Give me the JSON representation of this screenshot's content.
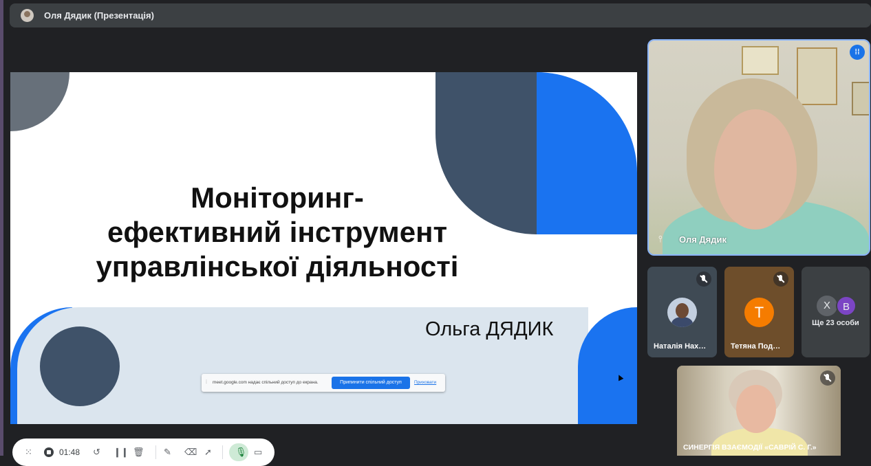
{
  "window": {
    "title": "Оля Дядик (Презентація)"
  },
  "slide": {
    "title_lines": [
      "Моніторинг-",
      "ефективний інструмент",
      "управлінської діяльності"
    ],
    "author": "Ольга ДЯДИК"
  },
  "share_bar": {
    "message": "meet.google.com надає спільний доступ до екрана.",
    "stop_label": "Припинити спільний доступ",
    "hide_label": "Приховати"
  },
  "participants": {
    "main": {
      "name": "Оля Дядик",
      "speaking": true
    },
    "tiles": [
      {
        "name": "Наталія Нах…",
        "muted": true
      },
      {
        "name": "Тетяна Под…",
        "initial": "Т",
        "muted": true,
        "color": "#f57c00"
      }
    ],
    "more": {
      "initials": [
        "Х",
        "В"
      ],
      "label": "Ще 23 особи"
    },
    "bottom": {
      "name": "СИНЕРГІЯ ВЗАЄМОДІЇ «САВРІЙ С. Г.»",
      "muted": true
    }
  },
  "recorder": {
    "elapsed": "01:48"
  },
  "colors": {
    "accent_blue": "#1a73f0",
    "slide_dark": "#3f5269",
    "meet_bg": "#202124"
  }
}
